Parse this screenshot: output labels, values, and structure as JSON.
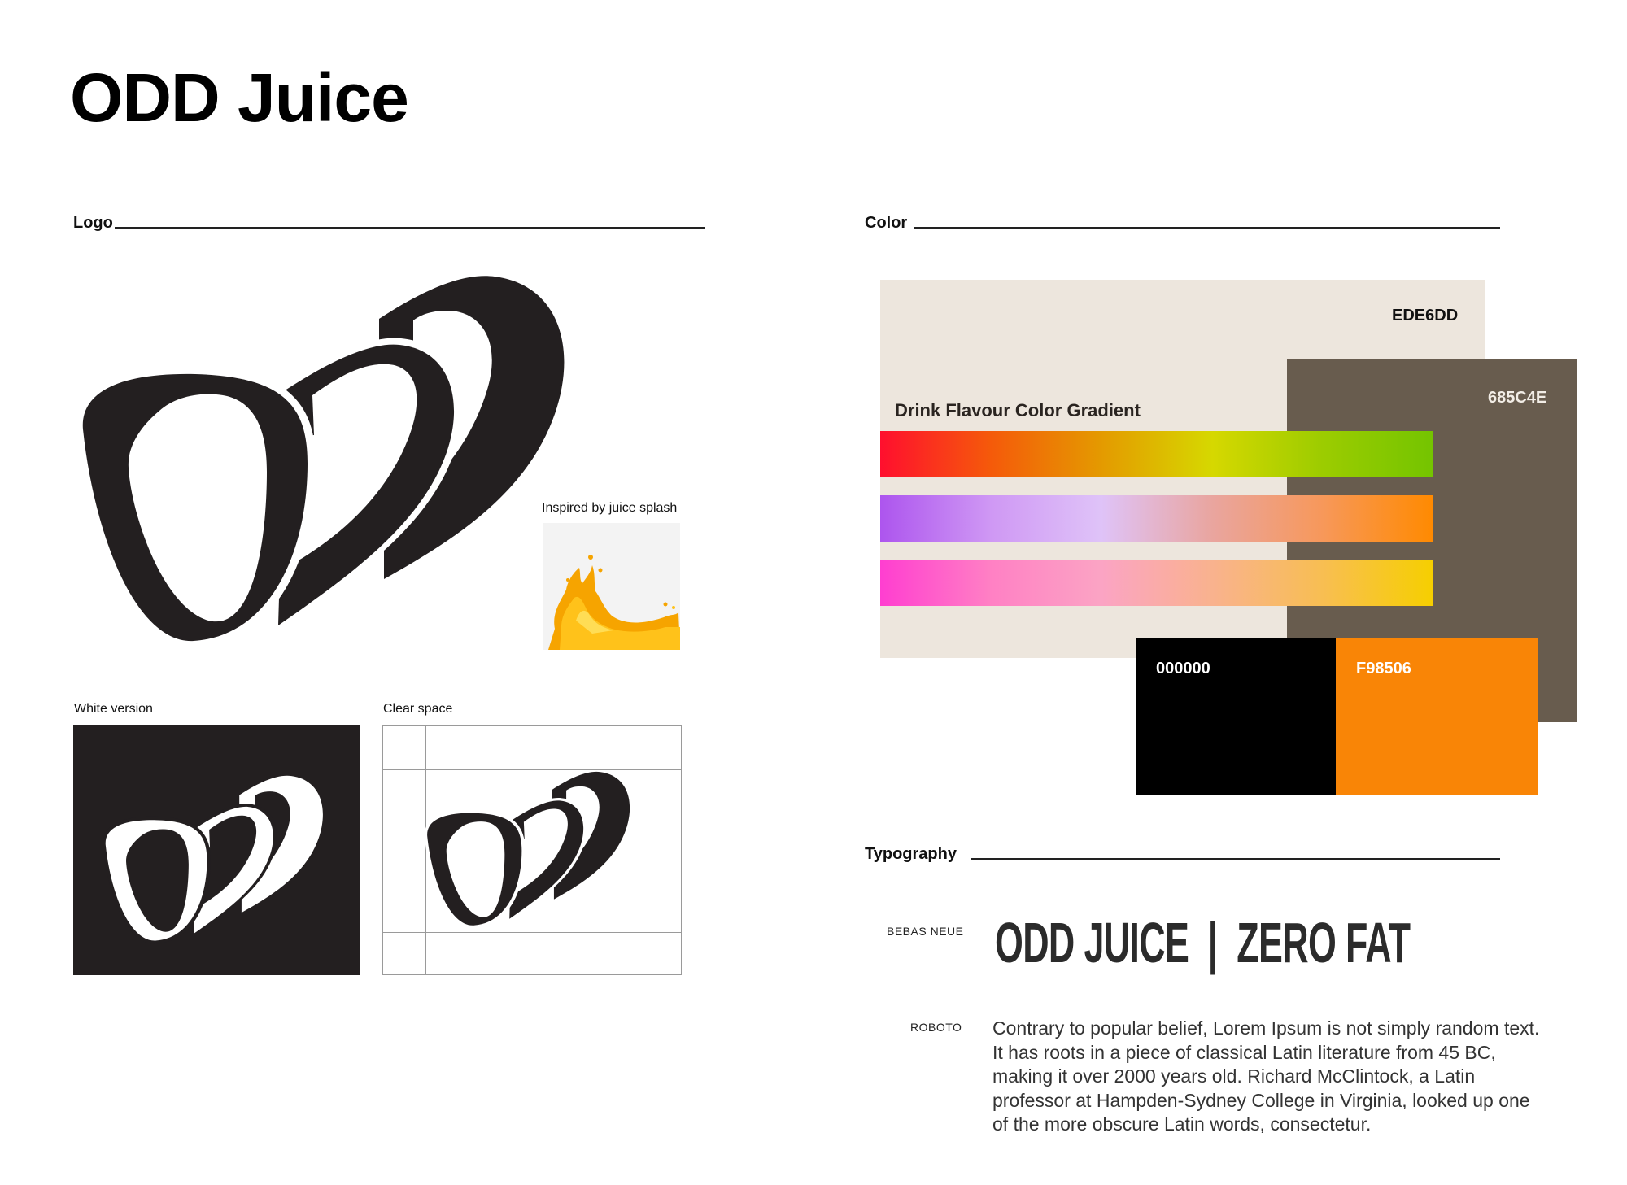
{
  "title": "ODD Juice",
  "logo_section": {
    "label": "Logo",
    "inspiration_caption": "Inspired by juice splash",
    "white_version_caption": "White version",
    "clear_space_caption": "Clear space"
  },
  "color_section": {
    "label": "Color",
    "gradient_title": "Drink Flavour Color Gradient",
    "swatches": [
      {
        "hex_label": "EDE6DD",
        "color": "#EDE6DD"
      },
      {
        "hex_label": "685C4E",
        "color": "#685C4E"
      },
      {
        "hex_label": "000000",
        "color": "#000000"
      },
      {
        "hex_label": "F98506",
        "color": "#F98506"
      }
    ],
    "gradients": [
      [
        "#ff0f2e",
        "#f55a0a",
        "#e49a00",
        "#d6d800",
        "#9ccc00",
        "#74c400"
      ],
      [
        "#ad55ee",
        "#cf98f4",
        "#dfc3f8",
        "#e9a59f",
        "#f7985a",
        "#ff8a00"
      ],
      [
        "#ff3ed0",
        "#ff80c4",
        "#fba4c4",
        "#f9b28e",
        "#f8be52",
        "#f6cf00"
      ]
    ]
  },
  "typography_section": {
    "label": "Typography",
    "fonts": [
      {
        "name": "BEBAS NEUE",
        "sample": "ODD JUICE  |  ZERO FAT"
      },
      {
        "name": "ROBOTO",
        "sample": "Contrary to popular belief, Lorem Ipsum is not simply random text. It has roots in a piece of classical Latin literature from 45 BC, making it over 2000 years old. Richard McClintock, a Latin professor at Hampden-Sydney College in Virginia, looked up one of the more obscure Latin words, consectetur."
      }
    ]
  }
}
